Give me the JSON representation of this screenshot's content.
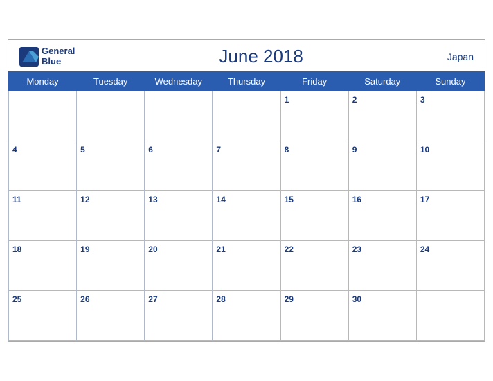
{
  "header": {
    "logo_line1": "General",
    "logo_line2": "Blue",
    "title": "June 2018",
    "country": "Japan"
  },
  "days_of_week": [
    "Monday",
    "Tuesday",
    "Wednesday",
    "Thursday",
    "Friday",
    "Saturday",
    "Sunday"
  ],
  "weeks": [
    [
      null,
      null,
      null,
      null,
      1,
      2,
      3
    ],
    [
      4,
      5,
      6,
      7,
      8,
      9,
      10
    ],
    [
      11,
      12,
      13,
      14,
      15,
      16,
      17
    ],
    [
      18,
      19,
      20,
      21,
      22,
      23,
      24
    ],
    [
      25,
      26,
      27,
      28,
      29,
      30,
      null
    ]
  ]
}
